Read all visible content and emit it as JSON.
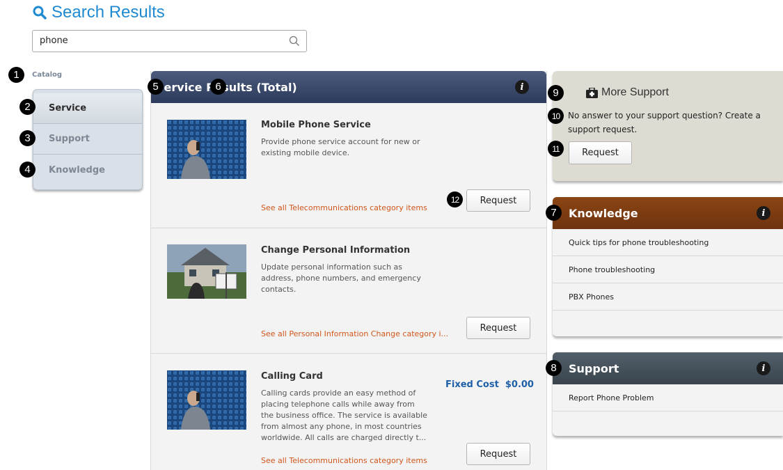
{
  "page": {
    "title": "Search Results"
  },
  "search": {
    "value": "phone"
  },
  "sidebar": {
    "catalog_label": "Catalog",
    "items": [
      {
        "label": "Service",
        "active": true
      },
      {
        "label": "Support"
      },
      {
        "label": "Knowledge"
      }
    ]
  },
  "results": {
    "header_title": "Service Results (Total)",
    "items": [
      {
        "title": "Mobile Phone Service",
        "description": "Provide phone service account for new or existing mobile device.",
        "link": "See all Telecommunications category items",
        "button": "Request",
        "image": "person-on-phone-photo"
      },
      {
        "title": "Change Personal Information",
        "description": "Update personal information such as address, phone numbers, and emergency contacts.",
        "link": "See all Personal Information Change category i...",
        "button": "Request",
        "image": "house-for-sale-photo"
      },
      {
        "title": "Calling Card",
        "description": "Calling cards provide an easy method of placing telephone calls while away from the business office. The service is available from almost any phone, in most countries worldwide. All calls are charged directly t...",
        "cost_label": "Fixed Cost",
        "cost_value": "$0.00",
        "link": "See all Telecommunications category items",
        "button": "Request",
        "image": "person-on-phone-photo"
      }
    ]
  },
  "more_support": {
    "title": "More Support",
    "text": "No answer to your support question? Create a support request.",
    "button": "Request"
  },
  "knowledge": {
    "title": "Knowledge",
    "items": [
      "Quick tips for phone troubleshooting",
      "Phone troubleshooting",
      "PBX Phones"
    ]
  },
  "support": {
    "title": "Support",
    "items": [
      "Report Phone Problem"
    ]
  },
  "markers": [
    "1",
    "2",
    "3",
    "4",
    "5",
    "6",
    "7",
    "8",
    "9",
    "10",
    "11",
    "12"
  ],
  "colors": {
    "title_blue": "#1f8ad1",
    "results_header": "#34415f",
    "knowledge_header": "#7a3b10",
    "support_header": "#3f4c56",
    "link_orange": "#d1561b",
    "cost_blue": "#1e5fa8"
  }
}
